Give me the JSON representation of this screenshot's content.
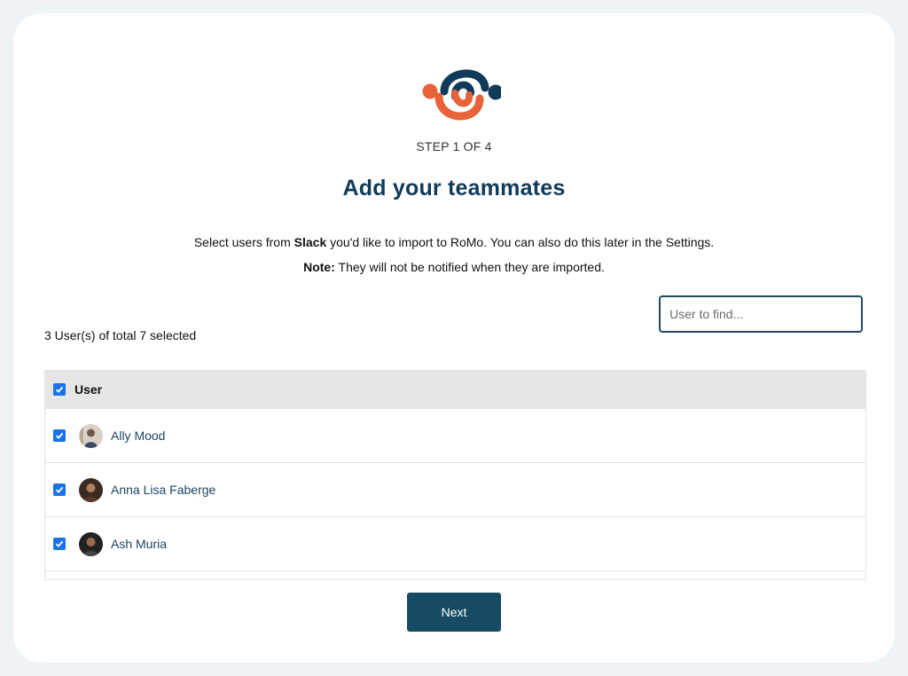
{
  "brand": {
    "logo_icon": "linked-rings-logo-icon",
    "colors": {
      "orange": "#e8623a",
      "navy": "#0f3a58"
    }
  },
  "step_label": "STEP 1 OF 4",
  "title": "Add your teammates",
  "description": {
    "prefix": "Select users from ",
    "source": "Slack",
    "suffix": " you'd like to import to RoMo. You can also do this later in the Settings."
  },
  "note": {
    "label": "Note:",
    "text": " They will not be notified when they are imported."
  },
  "search": {
    "placeholder": "User to find..."
  },
  "selection_summary": "3 User(s) of total 7 selected",
  "table": {
    "header": "User",
    "header_checked": true,
    "rows": [
      {
        "name": "Ally Mood",
        "checked": true,
        "avatar": "user-avatar-icon"
      },
      {
        "name": "Anna Lisa Faberge",
        "checked": true,
        "avatar": "user-avatar-icon"
      },
      {
        "name": "Ash Muria",
        "checked": true,
        "avatar": "user-avatar-icon"
      }
    ]
  },
  "next_label": "Next",
  "checkbox_color": "#1a73e8"
}
